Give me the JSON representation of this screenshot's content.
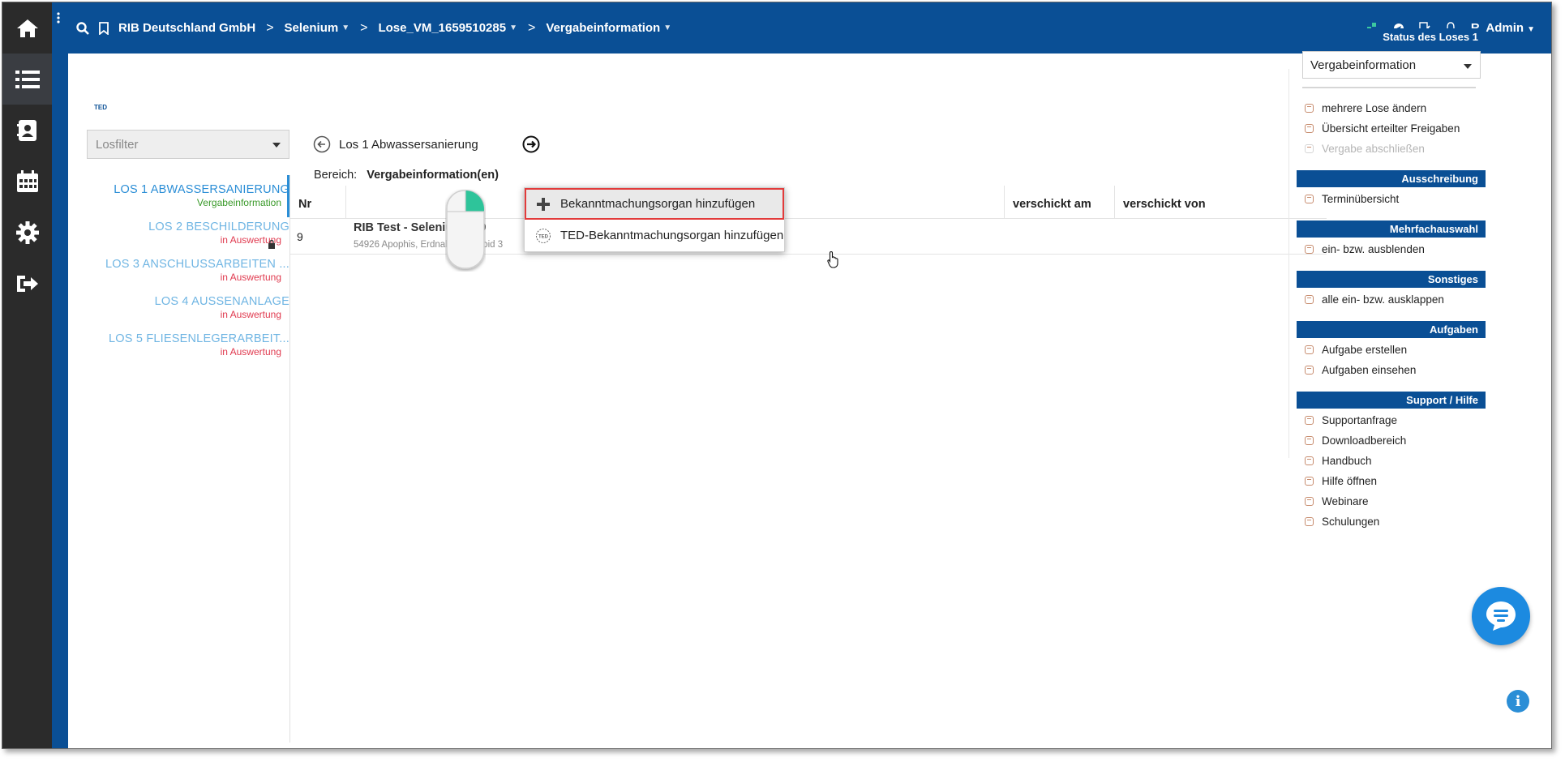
{
  "header": {
    "crumbs": [
      "RIB Deutschland GmbH",
      "Selenium",
      "Lose_VM_1659510285",
      "Vergabeinformation"
    ],
    "user": "R. Admin"
  },
  "leftbar": {
    "items": [
      "home-icon",
      "list-icon",
      "contacts-icon",
      "calendar-icon",
      "settings-icon",
      "logout-icon"
    ]
  },
  "main": {
    "ted_logo": "TED",
    "losfilter_placeholder": "Losfilter",
    "lose": [
      {
        "title": "LOS 1 ABWASSERSANIERUNG",
        "status": "Vergabeinformation"
      },
      {
        "title": "LOS 2 BESCHILDERUNG",
        "status": "in Auswertung"
      },
      {
        "title": "LOS 3 ANSCHLUSSARBEITEN ...",
        "status": "in Auswertung"
      },
      {
        "title": "LOS 4 AUSSENANLAGE",
        "status": "in Auswertung"
      },
      {
        "title": "LOS 5 FLIESENLEGERARBEIT...",
        "status": "in Auswertung"
      }
    ],
    "current_los": "Los 1 Abwassersanierung",
    "bereich_label": "Bereich:",
    "bereich_value": "Vergabeinformation(en)",
    "table": {
      "columns": [
        "Nr",
        "",
        "verschickt am",
        "verschickt von"
      ],
      "rows": [
        {
          "nr": "9",
          "title": "RIB Test - Selenium 009",
          "sub": "54926 Apophis, Erdnaher Asteroid 3"
        }
      ]
    }
  },
  "context_menu": {
    "items": [
      "Bekanntmachungsorgan hinzufügen",
      "TED-Bekanntmachungsorgan hinzufügen"
    ]
  },
  "right_panel": {
    "status_header": "Status des Loses 1",
    "status_select": "Vergabeinformation",
    "status_actions": [
      {
        "label": "mehrere Lose ändern",
        "disabled": false
      },
      {
        "label": "Übersicht erteilter Freigaben",
        "disabled": false
      },
      {
        "label": "Vergabe abschließen",
        "disabled": true
      }
    ],
    "groups": [
      {
        "header": "Ausschreibung",
        "items": [
          "Terminübersicht"
        ]
      },
      {
        "header": "Mehrfachauswahl",
        "items": [
          "ein- bzw. ausblenden"
        ]
      },
      {
        "header": "Sonstiges",
        "items": [
          "alle ein- bzw. ausklappen"
        ]
      },
      {
        "header": "Aufgaben",
        "items": [
          "Aufgabe erstellen",
          "Aufgaben einsehen"
        ]
      },
      {
        "header": "Support / Hilfe",
        "items": [
          "Supportanfrage",
          "Downloadbereich",
          "Handbuch",
          "Hilfe öffnen",
          "Webinare",
          "Schulungen"
        ]
      }
    ]
  },
  "colors": {
    "brand_blue": "#0a4f95",
    "sidebar_dark": "#2b2b2b",
    "link_blue": "#6fb5e3",
    "status_red": "#e03a4f",
    "status_green": "#3a9a2a",
    "highlight_red": "#e23b3b"
  }
}
